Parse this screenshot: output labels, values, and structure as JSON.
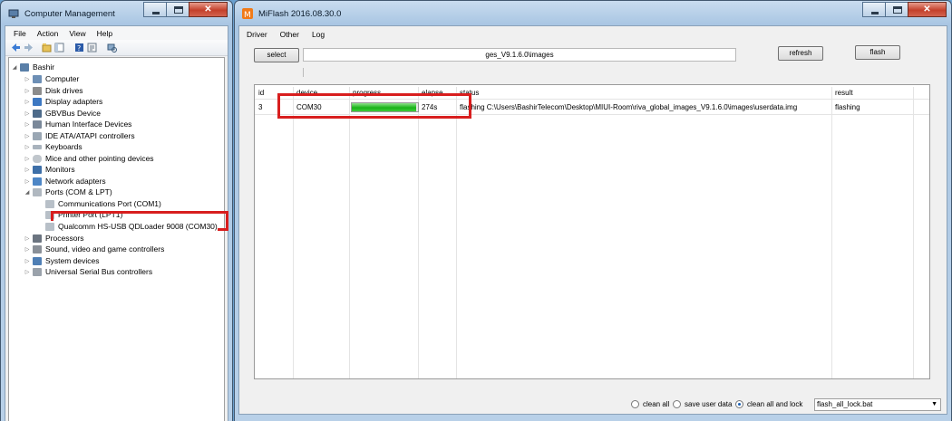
{
  "cm": {
    "title": "Computer Management",
    "caption": {
      "minimize": "",
      "maximize": "",
      "close": "✕"
    },
    "menu": [
      "File",
      "Action",
      "View",
      "Help"
    ],
    "tree": {
      "root": "Bashir",
      "items": [
        "Computer",
        "Disk drives",
        "Display adapters",
        "GBVBus Device",
        "Human Interface Devices",
        "IDE ATA/ATAPI controllers",
        "Keyboards",
        "Mice and other pointing devices",
        "Monitors",
        "Network adapters",
        "Ports (COM & LPT)",
        "Communications Port (COM1)",
        "Printer Port (LPT1)",
        "Qualcomm HS-USB QDLoader 9008 (COM30)",
        "Processors",
        "Sound, video and game controllers",
        "System devices",
        "Universal Serial Bus controllers"
      ]
    }
  },
  "mf": {
    "title": "MiFlash 2016.08.30.0",
    "caption": {
      "minimize": "",
      "maximize": "",
      "close": "✕"
    },
    "menu": [
      "Driver",
      "Other",
      "Log"
    ],
    "select_label": "select",
    "path": "ges_V9.1.6.0\\images",
    "refresh_label": "refresh",
    "flash_label": "flash",
    "columns": [
      "id",
      "device",
      "progress",
      "elapse",
      "status",
      "result"
    ],
    "row": {
      "id": "3",
      "device": "COM30",
      "progress": 0.97,
      "elapse": "274s",
      "status": "flashing C:\\Users\\BashirTelecom\\Desktop\\MIUI-Room\\riva_global_images_V9.1.6.0\\images\\userdata.img",
      "result": "flashing"
    },
    "options": {
      "clean_all": "clean all",
      "save_user_data": "save user data",
      "clean_all_lock": "clean all and lock",
      "selected": "clean all and lock",
      "script": "flash_all_lock.bat"
    }
  },
  "colors": {
    "highlight": "#d81e1e",
    "progress": "#18b318"
  }
}
